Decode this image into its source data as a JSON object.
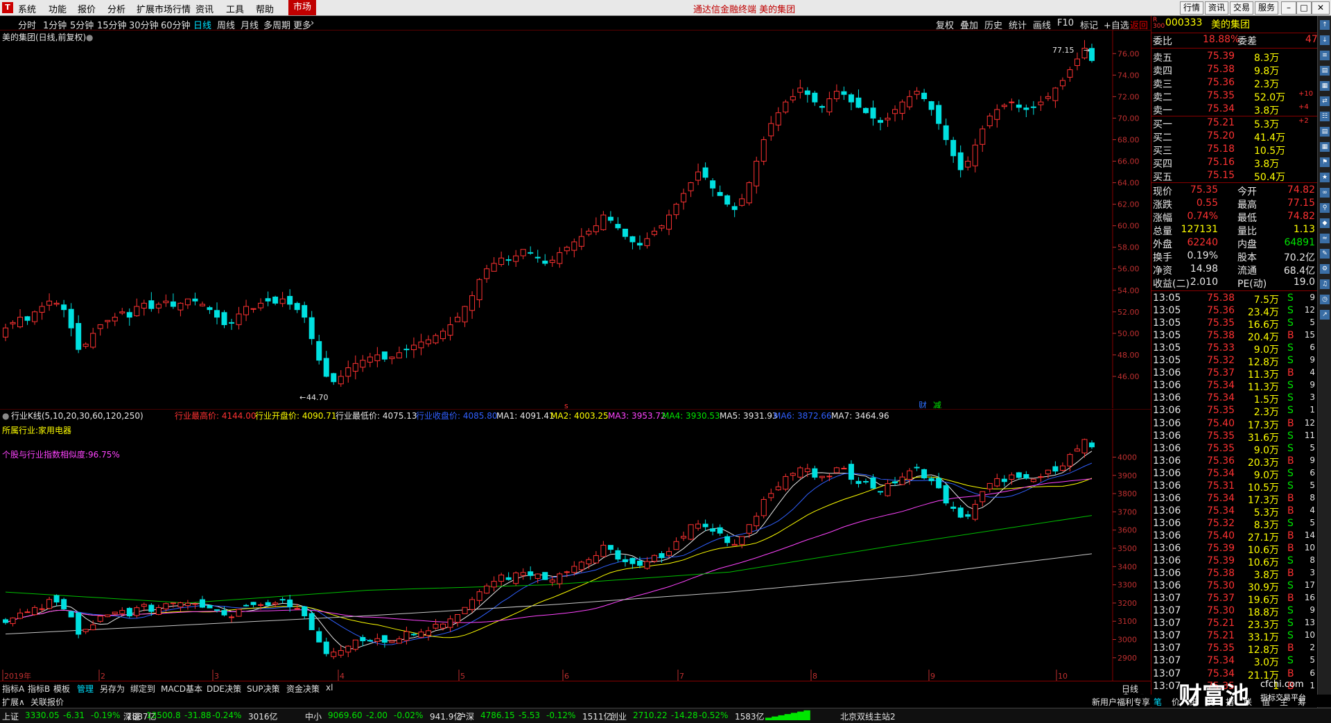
{
  "menubar": {
    "items": [
      "系统",
      "功能",
      "报价",
      "分析",
      "扩展市场行情",
      "资讯",
      "工具",
      "帮助"
    ],
    "market_tab": "市场",
    "title": "通达信金融终端  美的集团",
    "right_buttons": [
      "行情",
      "资讯",
      "交易",
      "服务"
    ]
  },
  "periods": {
    "items": [
      "分时",
      "1分钟",
      "5分钟",
      "15分钟",
      "30分钟",
      "60分钟",
      "日线",
      "周线",
      "月线",
      "多周期",
      "更多"
    ],
    "selected": "日线",
    "right_items": [
      "复权",
      "叠加",
      "历史",
      "统计",
      "画线",
      "F10",
      "标记",
      "+自选",
      "返回"
    ]
  },
  "upper_chart": {
    "title": "美的集团(日线,前复权)",
    "max_label": "77.15",
    "min_label": "44.70",
    "markers": [
      "财",
      "减"
    ],
    "price_ticks": [
      "76.00",
      "74.00",
      "72.00",
      "70.00",
      "68.00",
      "66.00",
      "64.00",
      "62.00",
      "60.00",
      "58.00",
      "56.00",
      "54.00",
      "52.00",
      "50.00",
      "48.00",
      "46.00"
    ]
  },
  "lower_chart": {
    "title": "行业K线(5,10,20,30,60,120,250)",
    "industry_label": "所属行业:家用电器",
    "similarity_label": "个股与行业指数相似度:96.75%",
    "legend": [
      {
        "text": "行业最高价: 4144.00",
        "color": "#ff3232"
      },
      {
        "text": "行业开盘价: 4090.71",
        "color": "#ffff00"
      },
      {
        "text": "行业最低价: 4075.13",
        "color": "#e8e8e8"
      },
      {
        "text": "行业收盘价: 4085.80",
        "color": "#3060ff"
      },
      {
        "text": "MA1: 4091.41",
        "color": "#e8e8e8"
      },
      {
        "text": "MA2: 4003.25",
        "color": "#ffff00"
      },
      {
        "text": "MA3: 3953.72",
        "color": "#ff44ff"
      },
      {
        "text": "MA4: 3930.53",
        "color": "#00e600"
      },
      {
        "text": "MA5: 3931.93",
        "color": "#e8e8e8"
      },
      {
        "text": "MA6: 3872.66",
        "color": "#3060ff"
      },
      {
        "text": "MA7: 3464.96",
        "color": "#e8e8e8"
      }
    ],
    "ticks": [
      "4000",
      "3900",
      "3800",
      "3700",
      "3600",
      "3500",
      "3400",
      "3300",
      "3200",
      "3100",
      "3000",
      "2900"
    ],
    "date_labels": [
      "2019年",
      "2",
      "3",
      "4",
      "5",
      "6",
      "7",
      "8",
      "9",
      "10"
    ],
    "period_label": "日线"
  },
  "chart_data": [
    {
      "type": "candlestick",
      "title": "美的集团(日线,前复权)",
      "ylim": [
        44,
        77.5
      ],
      "high": 77.15,
      "low": 44.7,
      "close_path": [
        50.5,
        51,
        51.5,
        51.2,
        52,
        52.5,
        53,
        52.8,
        52.2,
        50.5,
        48.5,
        49,
        50,
        50.8,
        51.2,
        51.5,
        52,
        51.5,
        52.5,
        52.8,
        52.3,
        52.7,
        53,
        52.5,
        52.8,
        53.2,
        53,
        52.7,
        52.2,
        51.5,
        50.8,
        51,
        51.8,
        52.5,
        52.3,
        52.8,
        53,
        52.8,
        53.2,
        52.7,
        52.2,
        51.5,
        49.5,
        47.5,
        46,
        45.5,
        46,
        46.8,
        47.2,
        47.5,
        47.8,
        48,
        47.6,
        47.8,
        48.2,
        48.5,
        48.9,
        49.2,
        49.4,
        49.8,
        50.2,
        50.8,
        51.5,
        52.5,
        53.5,
        55,
        56,
        56.5,
        57,
        56.8,
        57.2,
        57.8,
        57.5,
        57,
        56.5,
        56.8,
        57.5,
        58,
        58.5,
        59,
        59.5,
        60,
        61,
        60.5,
        59.8,
        59,
        58.5,
        58.2,
        58.8,
        59.5,
        60,
        61,
        62,
        63,
        64,
        65,
        64.5,
        63.5,
        62.8,
        62,
        61.5,
        62.5,
        64,
        66,
        68,
        69.5,
        70.5,
        71.5,
        72,
        72.8,
        72.2,
        71.5,
        71,
        71.8,
        72.5,
        72.2,
        71.5,
        71,
        70.5,
        70,
        69.6,
        70,
        70.8,
        71.5,
        72,
        72.5,
        71.8,
        70.8,
        69.5,
        68,
        66.5,
        65.2,
        66,
        67.5,
        69,
        70.2,
        70.8,
        71.2,
        71.5,
        71,
        70.8,
        71,
        71.5,
        72,
        72.8,
        73.5,
        74.5,
        75.5,
        76.5,
        75.35
      ]
    },
    {
      "type": "candlestick",
      "title": "行业K线(5,10,20,30,60,120,250)",
      "ylim": [
        2850,
        4150
      ],
      "series": [
        {
          "name": "MA1",
          "value": 4091.41
        },
        {
          "name": "MA2",
          "value": 4003.25
        },
        {
          "name": "MA3",
          "value": 3953.72
        },
        {
          "name": "MA4",
          "value": 3930.53
        },
        {
          "name": "MA5",
          "value": 3931.93
        },
        {
          "name": "MA6",
          "value": 3872.66
        },
        {
          "name": "MA7",
          "value": 3464.96
        }
      ]
    }
  ],
  "quote": {
    "code": "000333",
    "name": "美的集团",
    "weibi_label": "委比",
    "weibi_value": "18.88%",
    "weicha_label": "委差",
    "weicha_value": "47",
    "asks": [
      {
        "label": "卖五",
        "price": "75.39",
        "vol": "8.3万",
        "chg": ""
      },
      {
        "label": "卖四",
        "price": "75.38",
        "vol": "9.8万",
        "chg": ""
      },
      {
        "label": "卖三",
        "price": "75.36",
        "vol": "2.3万",
        "chg": ""
      },
      {
        "label": "卖二",
        "price": "75.35",
        "vol": "52.0万",
        "chg": "+10"
      },
      {
        "label": "卖一",
        "price": "75.34",
        "vol": "3.8万",
        "chg": "+4"
      }
    ],
    "bids": [
      {
        "label": "买一",
        "price": "75.21",
        "vol": "5.3万",
        "chg": "+2"
      },
      {
        "label": "买二",
        "price": "75.20",
        "vol": "41.4万",
        "chg": ""
      },
      {
        "label": "买三",
        "price": "75.18",
        "vol": "10.5万",
        "chg": ""
      },
      {
        "label": "买四",
        "price": "75.16",
        "vol": "3.8万",
        "chg": ""
      },
      {
        "label": "买五",
        "price": "75.15",
        "vol": "50.4万",
        "chg": ""
      }
    ],
    "stats": [
      {
        "l1": "现价",
        "v1": "75.35",
        "l2": "今开",
        "v2": "74.82"
      },
      {
        "l1": "涨跌",
        "v1": "0.55",
        "l2": "最高",
        "v2": "77.15"
      },
      {
        "l1": "涨幅",
        "v1": "0.74%",
        "l2": "最低",
        "v2": "74.82"
      },
      {
        "l1": "总量",
        "v1": "127131",
        "l2": "量比",
        "v2": "1.13"
      },
      {
        "l1": "外盘",
        "v1": "62240",
        "l2": "内盘",
        "v2": "64891"
      },
      {
        "l1": "换手",
        "v1": "0.19%",
        "l2": "股本",
        "v2": "70.2亿"
      },
      {
        "l1": "净资",
        "v1": "14.98",
        "l2": "流通",
        "v2": "68.4亿"
      },
      {
        "l1": "收益(二)",
        "v1": "2.010",
        "l2": "PE(动)",
        "v2": "19.0"
      }
    ],
    "ticks": [
      {
        "t": "13:05",
        "p": "75.38",
        "v": "7.5万",
        "s": "S",
        "n": "9"
      },
      {
        "t": "13:05",
        "p": "75.36",
        "v": "23.4万",
        "s": "S",
        "n": "12"
      },
      {
        "t": "13:05",
        "p": "75.35",
        "v": "16.6万",
        "s": "S",
        "n": "5"
      },
      {
        "t": "13:05",
        "p": "75.38",
        "v": "20.4万",
        "s": "B",
        "n": "15"
      },
      {
        "t": "13:05",
        "p": "75.33",
        "v": "9.0万",
        "s": "S",
        "n": "6"
      },
      {
        "t": "13:05",
        "p": "75.32",
        "v": "12.8万",
        "s": "S",
        "n": "9"
      },
      {
        "t": "13:06",
        "p": "75.37",
        "v": "11.3万",
        "s": "B",
        "n": "4"
      },
      {
        "t": "13:06",
        "p": "75.34",
        "v": "11.3万",
        "s": "S",
        "n": "9"
      },
      {
        "t": "13:06",
        "p": "75.34",
        "v": "1.5万",
        "s": "S",
        "n": "3"
      },
      {
        "t": "13:06",
        "p": "75.35",
        "v": "2.3万",
        "s": "S",
        "n": "1"
      },
      {
        "t": "13:06",
        "p": "75.40",
        "v": "17.3万",
        "s": "B",
        "n": "12"
      },
      {
        "t": "13:06",
        "p": "75.35",
        "v": "31.6万",
        "s": "S",
        "n": "11"
      },
      {
        "t": "13:06",
        "p": "75.35",
        "v": "9.0万",
        "s": "S",
        "n": "5"
      },
      {
        "t": "13:06",
        "p": "75.36",
        "v": "20.3万",
        "s": "B",
        "n": "9"
      },
      {
        "t": "13:06",
        "p": "75.34",
        "v": "9.0万",
        "s": "S",
        "n": "6"
      },
      {
        "t": "13:06",
        "p": "75.31",
        "v": "10.5万",
        "s": "S",
        "n": "5"
      },
      {
        "t": "13:06",
        "p": "75.34",
        "v": "17.3万",
        "s": "B",
        "n": "8"
      },
      {
        "t": "13:06",
        "p": "75.34",
        "v": "5.3万",
        "s": "B",
        "n": "4"
      },
      {
        "t": "13:06",
        "p": "75.32",
        "v": "8.3万",
        "s": "S",
        "n": "5"
      },
      {
        "t": "13:06",
        "p": "75.40",
        "v": "27.1万",
        "s": "B",
        "n": "14"
      },
      {
        "t": "13:06",
        "p": "75.39",
        "v": "10.6万",
        "s": "B",
        "n": "10"
      },
      {
        "t": "13:06",
        "p": "75.39",
        "v": "10.6万",
        "s": "S",
        "n": "8"
      },
      {
        "t": "13:06",
        "p": "75.38",
        "v": "3.8万",
        "s": "B",
        "n": "3"
      },
      {
        "t": "13:06",
        "p": "75.30",
        "v": "30.9万",
        "s": "S",
        "n": "17"
      },
      {
        "t": "13:07",
        "p": "75.37",
        "v": "19.6万",
        "s": "B",
        "n": "16"
      },
      {
        "t": "13:07",
        "p": "75.30",
        "v": "18.8万",
        "s": "S",
        "n": "9"
      },
      {
        "t": "13:07",
        "p": "75.21",
        "v": "23.3万",
        "s": "S",
        "n": "13"
      },
      {
        "t": "13:07",
        "p": "75.21",
        "v": "33.1万",
        "s": "S",
        "n": "10"
      },
      {
        "t": "13:07",
        "p": "75.35",
        "v": "12.8万",
        "s": "B",
        "n": "2"
      },
      {
        "t": "13:07",
        "p": "75.34",
        "v": "3.0万",
        "s": "S",
        "n": "5"
      },
      {
        "t": "13:07",
        "p": "75.34",
        "v": "21.1万",
        "s": "B",
        "n": "6"
      },
      {
        "t": "13:07",
        "p": "75.35",
        "v": "1",
        "s": "B",
        "n": "1"
      }
    ],
    "bottom_tabs": [
      "笔",
      "价",
      "细",
      "势",
      "指",
      "联",
      "值",
      "主",
      "筹"
    ]
  },
  "tabbar": [
    "指标A",
    "指标B",
    "模板",
    "管理",
    "另存为",
    "绑定到",
    "MACD基本",
    "DDE决策",
    "SUP决策",
    "资金决策",
    "xl"
  ],
  "tabbar_selected": "管理",
  "subbar": {
    "left": [
      "扩展∧",
      "关联报价"
    ],
    "right": "新用户福利专享"
  },
  "statusbar": [
    {
      "name": "上证",
      "price": "3330.05",
      "chg": "-6.31",
      "pct": "-0.19%",
      "amt": "1887亿"
    },
    {
      "name": "深证",
      "price": "13500.8",
      "chg": "-31.88",
      "pct": "-0.24%",
      "amt": "3016亿"
    },
    {
      "name": "中小",
      "price": "9069.60",
      "chg": "-2.00",
      "pct": "-0.02%",
      "amt": "941.9亿"
    },
    {
      "name": "沪深",
      "price": "4786.15",
      "chg": "-5.53",
      "pct": "-0.12%",
      "amt": "1511亿"
    },
    {
      "name": "创业",
      "price": "2710.22",
      "chg": "-14.28",
      "pct": "-0.52%",
      "amt": "1583亿"
    }
  ],
  "status_right": "北京双线主站2",
  "watermark": {
    "big": "财富池",
    "site": "cfchi.com",
    "sub": "指标交易平台"
  }
}
